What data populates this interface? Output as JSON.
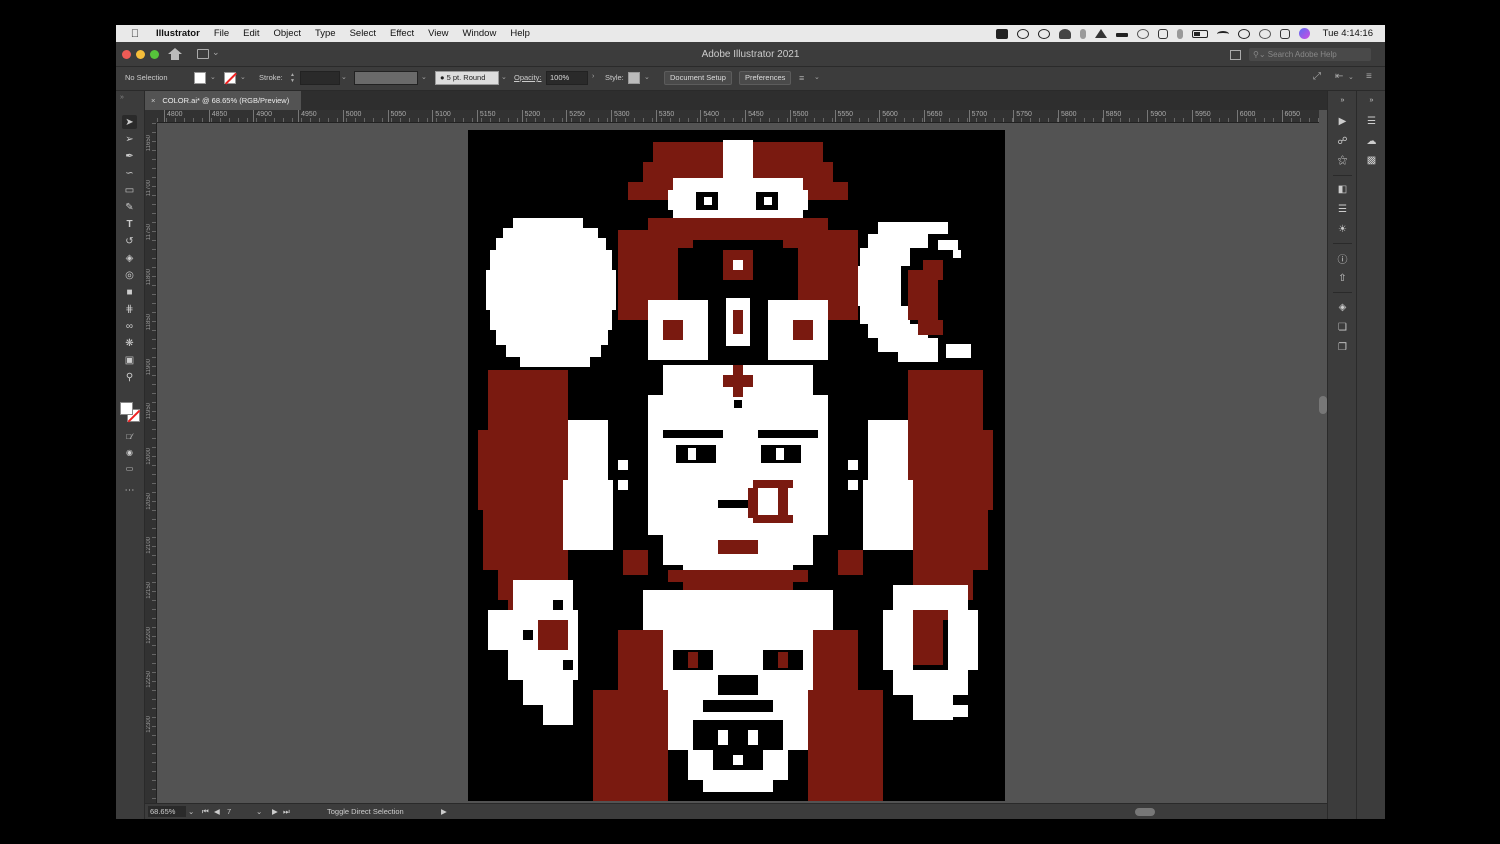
{
  "menubar": {
    "app_name": "Illustrator",
    "items": [
      "File",
      "Edit",
      "Object",
      "Type",
      "Select",
      "Effect",
      "View",
      "Window",
      "Help"
    ],
    "clock": "Tue 4:14:16"
  },
  "titlebar": {
    "title": "Adobe Illustrator 2021",
    "search_placeholder": "Search Adobe Help"
  },
  "controlbar": {
    "selection_label": "No Selection",
    "stroke_label": "Stroke:",
    "brush_label": "5 pt. Round",
    "opacity_label": "Opacity:",
    "opacity_value": "100%",
    "style_label": "Style:",
    "document_setup": "Document Setup",
    "preferences": "Preferences"
  },
  "document": {
    "tab_title": "COLOR.ai* @ 68.65% (RGB/Preview)",
    "close_glyph": "×"
  },
  "ruler": {
    "h_labels": [
      "4800",
      "4850",
      "4900",
      "4950",
      "5000",
      "5050",
      "5100",
      "5150",
      "5200",
      "5250",
      "5300",
      "5350",
      "5400",
      "5450",
      "5500",
      "5550",
      "5600",
      "5650",
      "5700",
      "5750",
      "5800",
      "5850",
      "5900",
      "5950",
      "6000",
      "6050"
    ],
    "v_labels": [
      "11650",
      "11700",
      "11750",
      "11800",
      "11850",
      "11900",
      "11950",
      "12000",
      "12050",
      "12100",
      "12150",
      "12200",
      "12250",
      "12300"
    ]
  },
  "statusbar": {
    "zoom": "68.65%",
    "artboard_num": "7",
    "status_text": "Toggle Direct Selection"
  },
  "colors": {
    "art_red": "#7a1a10",
    "art_white": "#ffffff",
    "art_black": "#000000",
    "ui_dark": "#3c3c3c",
    "canvas": "#535353"
  },
  "icons": {
    "tools": [
      "selection-arrow-icon",
      "direct-selection-icon",
      "pen-icon",
      "curvature-icon",
      "rectangle-icon",
      "paintbrush-icon",
      "type-icon",
      "rotate-icon",
      "eraser-icon",
      "lasso-icon",
      "gradient-icon",
      "eyedropper-icon",
      "blend-icon",
      "symbol-sprayer-icon",
      "artboard-icon",
      "zoom-icon",
      "more-tools-icon"
    ],
    "dock": [
      "play-icon",
      "link-icon",
      "puppet-icon",
      "gradient-panel-icon",
      "align-icon",
      "appearance-icon",
      "info-icon",
      "export-icon",
      "layers-icon",
      "artboards-icon",
      "transform-icon"
    ]
  }
}
